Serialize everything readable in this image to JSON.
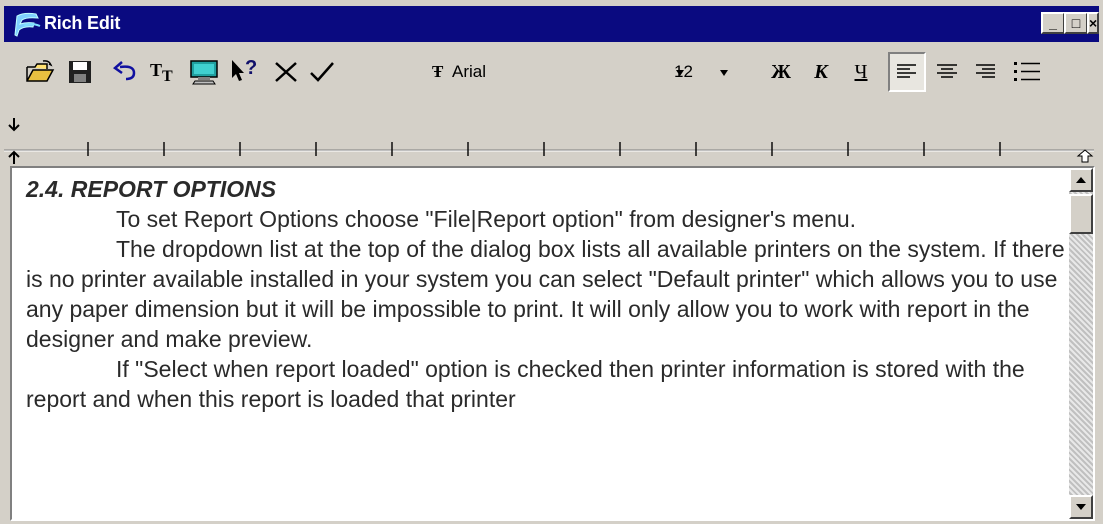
{
  "window": {
    "title": "Rich Edit",
    "controls": {
      "minimize": "_",
      "maximize": "□",
      "close": "×"
    }
  },
  "toolbar": {
    "font": {
      "icon": "Ŧ",
      "value": "Arial"
    },
    "size": {
      "value": "12"
    },
    "format": {
      "bold": "Ж",
      "italic": "К",
      "underline": "Ч"
    }
  },
  "document": {
    "heading": "2.4. REPORT OPTIONS",
    "paragraphs": [
      "To set Report Options choose \"File|Report option\" from designer's menu.",
      "The dropdown list at the top of the dialog box lists all available printers on the system. If there is no printer available installed in your system you can select \"Default printer\" which allows you to use any paper dimension but it will be impossible to print. It will only allow you to work with report in the designer and make preview.",
      "If \"Select when report loaded\" option is checked then printer information is stored with the report and when this report is loaded that printer"
    ]
  },
  "colors": {
    "titlebar": "#0a0a80",
    "face": "#d4d0c8",
    "editor_bg": "#ffffff",
    "text": "#2a2a2a"
  },
  "icons": [
    "app-logo-icon",
    "open-folder-icon",
    "save-disk-icon",
    "undo-icon",
    "font-icon",
    "insert-object-icon",
    "context-help-icon",
    "cancel-icon",
    "accept-icon",
    "bullets-icon"
  ]
}
